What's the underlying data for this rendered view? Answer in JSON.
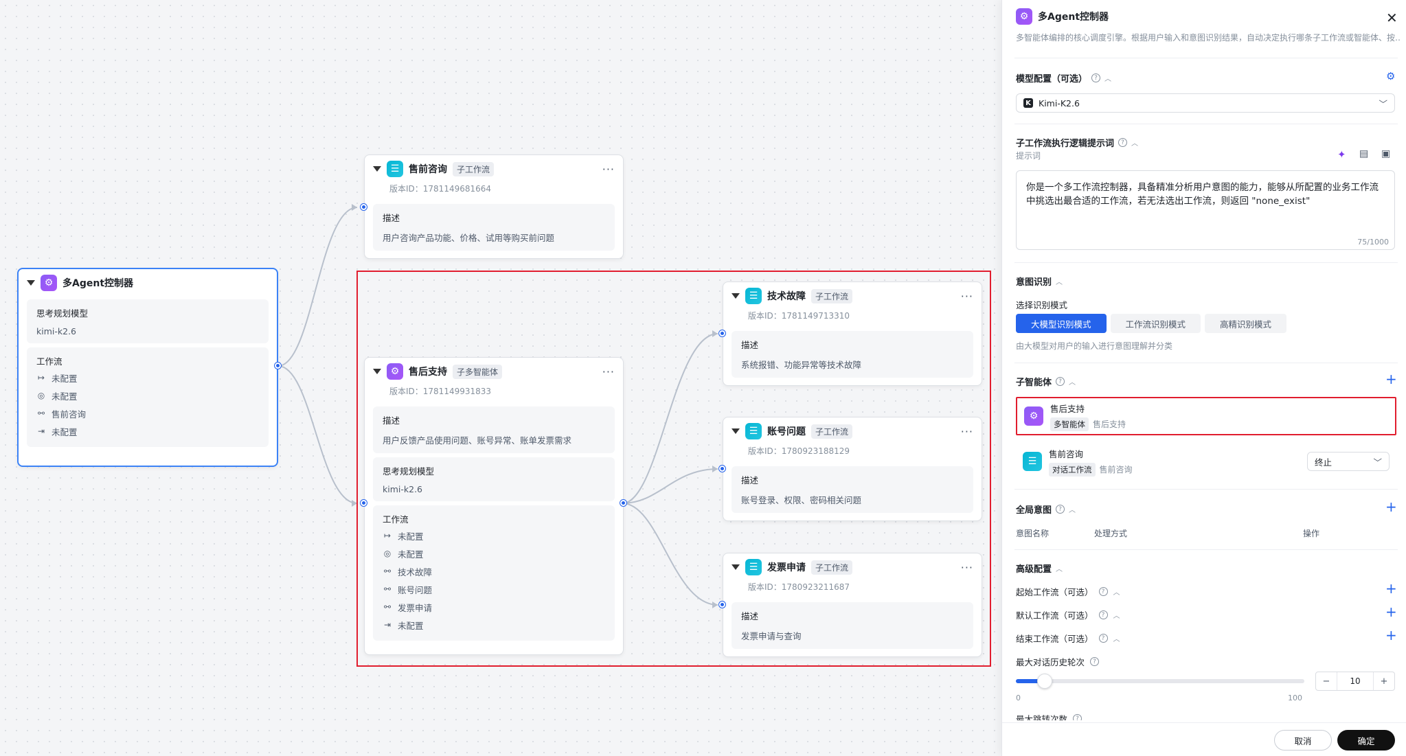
{
  "canvas": {
    "controller_node": {
      "title": "多Agent控制器",
      "model_label": "思考规划模型",
      "model_value": "kimi-k2.6",
      "workflow_label": "工作流",
      "workflow_items": [
        {
          "icon": "start-arrow-icon",
          "text": "未配置"
        },
        {
          "icon": "pin-icon",
          "text": "未配置"
        },
        {
          "icon": "flow-icon",
          "text": "售前咨询"
        },
        {
          "icon": "end-arrow-icon",
          "text": "未配置"
        }
      ]
    },
    "presales_node": {
      "title": "售前咨询",
      "tag": "子工作流",
      "version": "版本ID：1781149681664",
      "desc_label": "描述",
      "desc": "用户咨询产品功能、价格、试用等购买前问题"
    },
    "aftersales_node": {
      "title": "售后支持",
      "tag": "子多智能体",
      "version": "版本ID：1781149931833",
      "desc_label": "描述",
      "desc": "用户反馈产品使用问题、账号异常、账单发票需求",
      "model_label": "思考规划模型",
      "model_value": "kimi-k2.6",
      "workflow_label": "工作流",
      "workflow_items": [
        {
          "icon": "start-arrow-icon",
          "text": "未配置"
        },
        {
          "icon": "pin-icon",
          "text": "未配置"
        },
        {
          "icon": "flow-icon",
          "text": "技术故障"
        },
        {
          "icon": "flow-icon",
          "text": "账号问题"
        },
        {
          "icon": "flow-icon",
          "text": "发票申请"
        },
        {
          "icon": "end-arrow-icon",
          "text": "未配置"
        }
      ]
    },
    "tech_node": {
      "title": "技术故障",
      "tag": "子工作流",
      "version": "版本ID：1781149713310",
      "desc_label": "描述",
      "desc": "系统报错、功能异常等技术故障"
    },
    "account_node": {
      "title": "账号问题",
      "tag": "子工作流",
      "version": "版本ID：1780923188129",
      "desc_label": "描述",
      "desc": "账号登录、权限、密码相关问题"
    },
    "invoice_node": {
      "title": "发票申请",
      "tag": "子工作流",
      "version": "版本ID：1780923211687",
      "desc_label": "描述",
      "desc": "发票申请与查询"
    }
  },
  "panel": {
    "title": "多Agent控制器",
    "subtitle": "多智能体编排的核心调度引擎。根据用户输入和意图识别结果，自动决定执行哪条子工作流或智能体、按…",
    "model_section": "模型配置（可选）",
    "model_value": "Kimi-K2.6",
    "prompt_section": "子工作流执行逻辑提示词",
    "prompt_label": "提示词",
    "prompt_text": "你是一个多工作流控制器，具备精准分析用户意图的能力，能够从所配置的业务工作流中挑选出最合适的工作流，若无法选出工作流，则返回 \"none_exist\"",
    "prompt_count": "75/1000",
    "intent_section": "意图识别",
    "mode_label": "选择识别模式",
    "modes": [
      "大模型识别模式",
      "工作流识别模式",
      "高精识别模式"
    ],
    "mode_hint": "由大模型对用户的输入进行意图理解并分类",
    "sub_agent_section": "子智能体",
    "agents": [
      {
        "name": "售后支持",
        "badge": "多智能体",
        "sub": "售后支持"
      },
      {
        "name": "售前咨询",
        "badge": "对话工作流",
        "sub": "售前咨询",
        "action": "终止"
      }
    ],
    "global_intent_section": "全局意图",
    "table_headers": [
      "意图名称",
      "处理方式",
      "操作"
    ],
    "advanced_section": "高级配置",
    "start_wf": "起始工作流（可选）",
    "default_wf": "默认工作流（可选）",
    "end_wf": "结束工作流（可选）",
    "history_label": "最大对话历史轮次",
    "history_value": 10,
    "history_min": "0",
    "history_max": "100",
    "history_stepper": "10",
    "next_label": "最大跳转次数",
    "cancel": "取消",
    "confirm": "确定"
  },
  "colors": {
    "accent": "#2563eb",
    "highlight": "#e11d2e",
    "agent_icon": "#8b5cf6",
    "workflow_icon": "#06b6d4"
  }
}
